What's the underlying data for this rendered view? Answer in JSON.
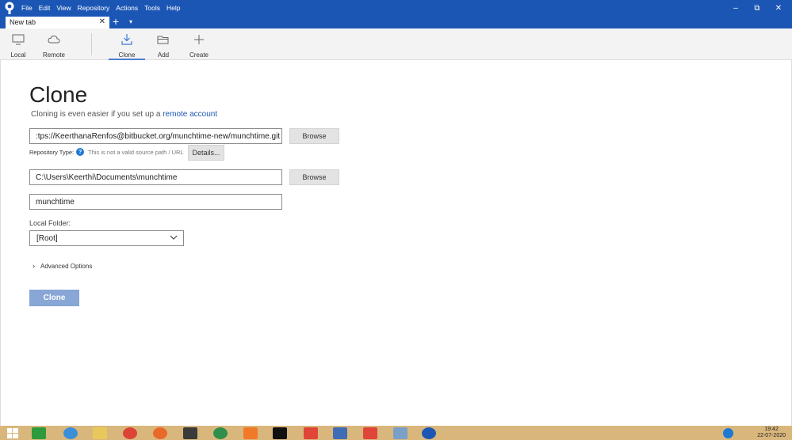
{
  "menu": [
    "File",
    "Edit",
    "View",
    "Repository",
    "Actions",
    "Tools",
    "Help"
  ],
  "window_controls": {
    "minimize": "–",
    "restore": "⧉",
    "close": "✕"
  },
  "tabs": [
    {
      "label": "New tab",
      "close": "✕"
    }
  ],
  "tab_add": "+",
  "tab_menu": "▾",
  "toolbar": {
    "local": "Local",
    "remote": "Remote",
    "clone": "Clone",
    "add": "Add",
    "create": "Create",
    "active": "clone"
  },
  "page": {
    "title": "Clone",
    "subtitle_prefix": "Cloning is even easier if you set up a ",
    "subtitle_link": "remote account"
  },
  "source": {
    "value": ":tps://KeerthanaRenfos@bitbucket.org/munchtime-new/munchtime.git",
    "browse": "Browse"
  },
  "repo_type": {
    "label": "Repository Type:",
    "icon": "?",
    "note": "This is not a valid source path / URL",
    "details": "Details..."
  },
  "destination": {
    "value": "C:\\Users\\Keerthi\\Documents\\munchtime",
    "browse": "Browse"
  },
  "name_field": {
    "value": "munchtime"
  },
  "local_folder": {
    "label": "Local Folder:",
    "selected": "[Root]"
  },
  "advanced": {
    "arrow": "›",
    "label": "Advanced Options"
  },
  "clone_button": "Clone",
  "clock": {
    "time": "19:42",
    "date": "22-07-2020"
  },
  "colors": {
    "accent": "#1c56b5",
    "clone_button": "#88a6d6",
    "taskbar": "#d9b77c"
  }
}
